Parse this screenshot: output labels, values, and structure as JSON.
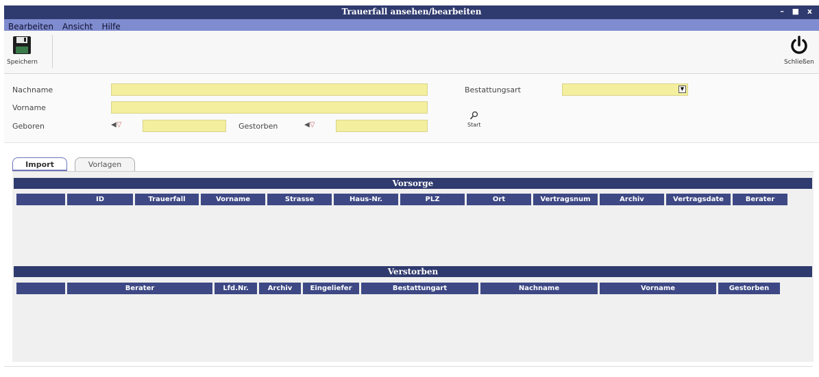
{
  "window": {
    "title": "Trauerfall ansehen/bearbeiten",
    "controls": "– ■ x"
  },
  "menu": [
    "Bearbeiten",
    "Ansicht",
    "Hilfe"
  ],
  "toolbar": {
    "save_label": "Speichern",
    "close_label": "Schließen"
  },
  "form": {
    "nachname_label": "Nachname",
    "vorname_label": "Vorname",
    "geboren_label": "Geboren",
    "gestorben_label": "Gestorben",
    "bestattungsart_label": "Bestattungsart",
    "start_label": "Start",
    "nachname_value": "",
    "vorname_value": "",
    "geboren_value": "",
    "gestorben_value": "",
    "bestattungsart_value": ""
  },
  "tabs": [
    {
      "label": "Import",
      "active": true
    },
    {
      "label": "Vorlagen",
      "active": false
    }
  ],
  "vorsorge": {
    "title": "Vorsorge",
    "columns": [
      "",
      "ID",
      "Trauerfall",
      "Vorname",
      "Strasse",
      "Haus-Nr.",
      "PLZ",
      "Ort",
      "Vertragsnum",
      "Archiv",
      "Vertragsdate",
      "Berater"
    ]
  },
  "verstorben": {
    "title": "Verstorben",
    "columns": [
      "",
      "Berater",
      "Lfd.Nr.",
      "Archiv",
      "Eingeliefer",
      "Bestattungart",
      "Nachname",
      "Vorname",
      "Gestorben"
    ]
  },
  "colors": {
    "titlebar": "#2f3a6e",
    "menubar": "#7f8ccf",
    "input_bg": "#f3ef9e",
    "header_cell": "#3d4884"
  }
}
